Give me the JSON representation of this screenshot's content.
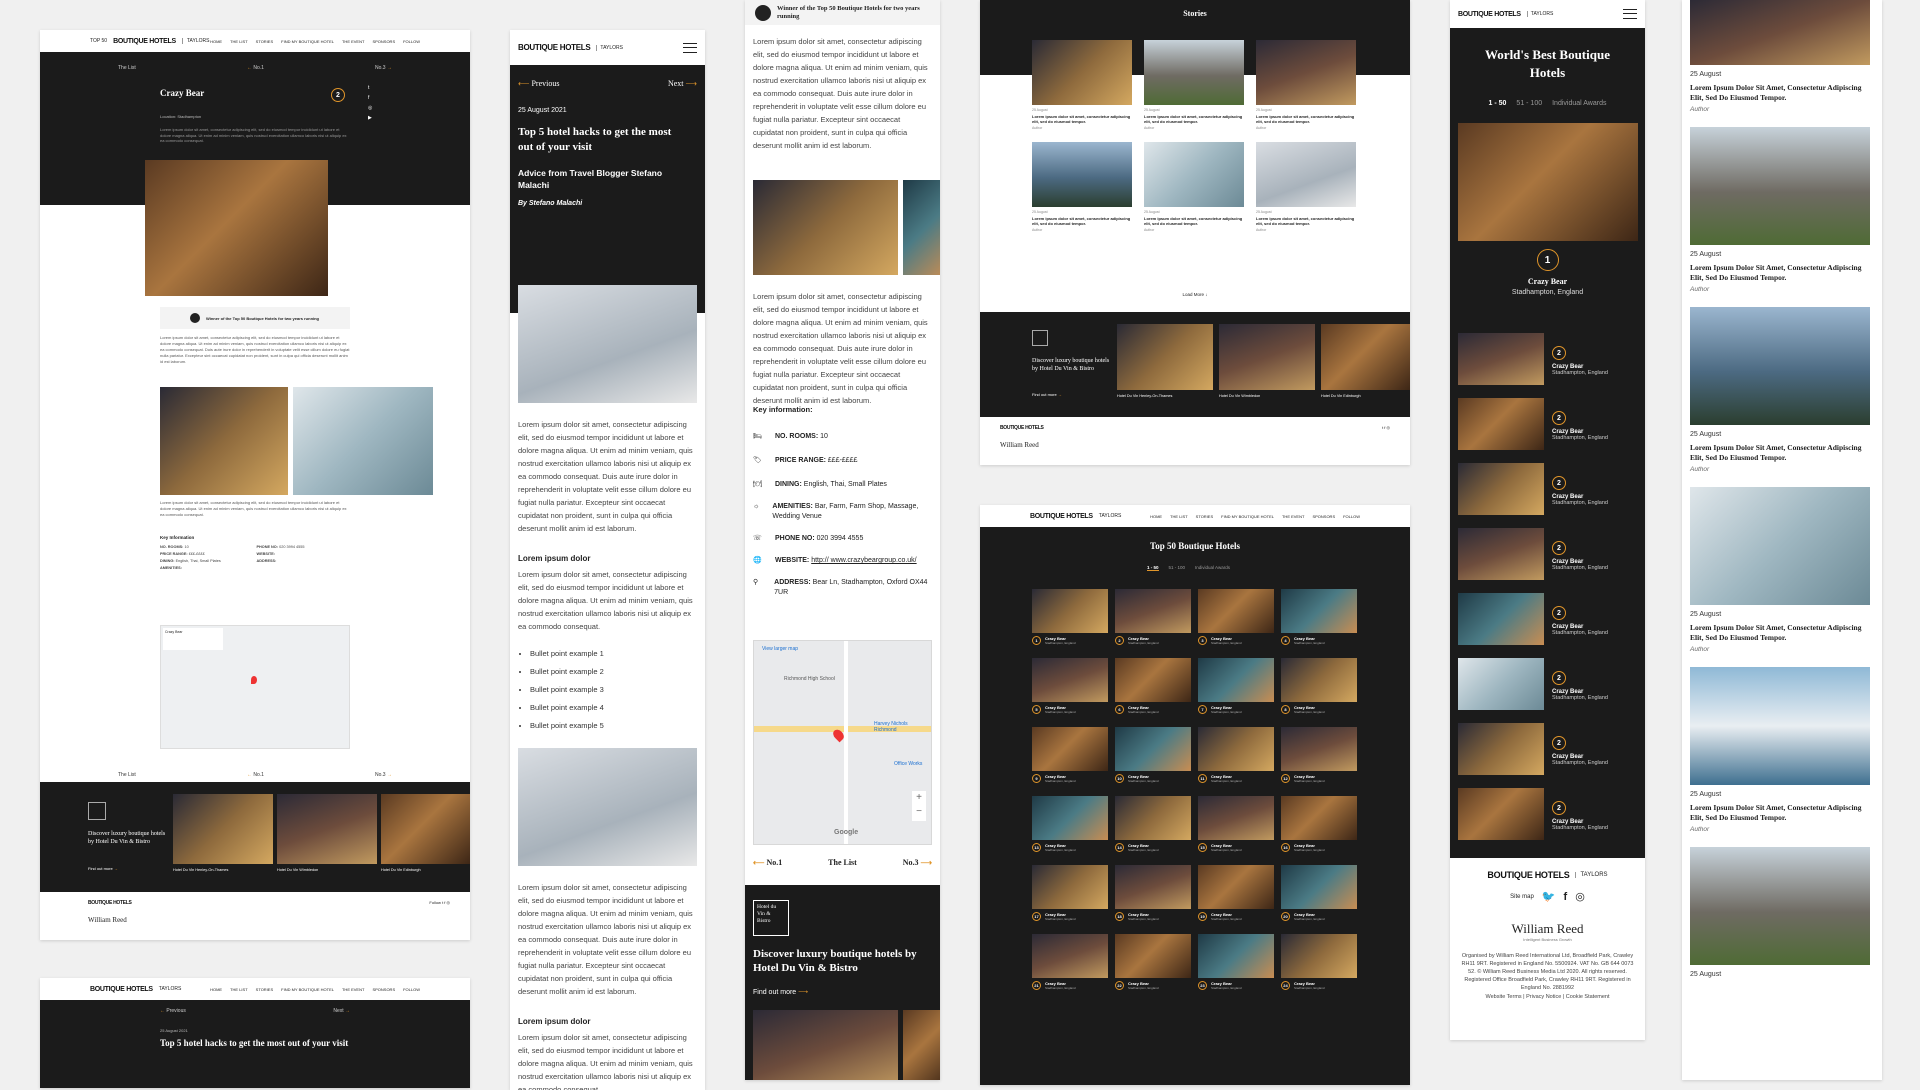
{
  "brand": {
    "name": "BOUTIQUE HOTELS",
    "prefix": "TOP 50",
    "partner": "TAYLORS"
  },
  "nav": [
    "HOME",
    "THE LIST",
    "STORIES",
    "FIND MY BOUTIQUE HOTEL",
    "THE EVENT",
    "SPONSORS",
    "FOLLOW"
  ],
  "colors": {
    "accent": "#e0952a",
    "dark": "#1f1f1f"
  },
  "p1": {
    "crumbs": {
      "list": "The List",
      "prev": "No.1",
      "next": "No.3"
    },
    "title": "Crazy Bear",
    "rank": "2",
    "location": "Location: Stadhampton",
    "winner": "Winner of the Top 50 Boutique Hotels for two years running",
    "key_info": "Key Information",
    "footer": {
      "discover": "Discover luxury boutique hotels by Hotel Du Vin & Bistro",
      "find": "Find out more",
      "hotels": [
        {
          "name": "Hotel Du Vin Henley-On-Thames",
          "loc": "Henley-on-Thames, England"
        },
        {
          "name": "Hotel Du Vin Wimbledon",
          "loc": "London, England"
        },
        {
          "name": "Hotel Du Vin Edinburgh",
          "loc": "Edinburgh, Scotland"
        }
      ],
      "follow": "Follow",
      "publisher": "William Reed"
    }
  },
  "p1b": {
    "prev": "Previous",
    "next": "Next",
    "date": "25 August 2021",
    "title": "Top 5 hotel hacks to get the most out of your visit"
  },
  "p2": {
    "prev": "Previous",
    "next": "Next",
    "date": "25 August 2021",
    "title": "Top 5 hotel hacks to get the most out of your visit",
    "subtitle": "Advice from Travel Blogger Stefano Malachi",
    "byline": "By Stefano Malachi",
    "lorem": "Lorem ipsum dolor sit amet, consectetur adipiscing elit, sed do eiusmod tempor incididunt ut labore et dolore magna aliqua. Ut enim ad minim veniam, quis nostrud exercitation ullamco laboris nisi ut aliquip ex ea commodo consequat. Duis aute irure dolor in reprehenderit in voluptate velit esse cillum dolore eu fugiat nulla pariatur. Excepteur sint occaecat cupidatat non proident, sunt in culpa qui officia deserunt mollit anim id est laborum.",
    "heading": "Lorem ipsum dolor",
    "lorem_short": "Lorem ipsum dolor sit amet, consectetur adipiscing elit, sed do eiusmod tempor incididunt ut labore et dolore magna aliqua. Ut enim ad minim veniam, quis nostrud exercitation ullamco laboris nisi ut aliquip ex ea commodo consequat.",
    "bullets": [
      "Bullet point example 1",
      "Bullet point example 2",
      "Bullet point example 3",
      "Bullet point example 4",
      "Bullet point example 5"
    ]
  },
  "p3": {
    "winner": "Winner of the Top 50 Boutique Hotels for two years running",
    "key_info": "Key information:",
    "info": [
      {
        "label": "NO. ROOMS:",
        "value": "10",
        "icon": "bed-icon"
      },
      {
        "label": "PRICE RANGE:",
        "value": "£££-££££",
        "icon": "price-tag-icon"
      },
      {
        "label": "DINING:",
        "value": "English, Thai, Small Plates",
        "icon": "dining-icon"
      },
      {
        "label": "AMENITIES:",
        "value": "Bar, Farm, Farm Shop, Massage, Wedding Venue",
        "icon": "amenities-icon"
      },
      {
        "label": "PHONE NO:",
        "value": "020 3994 4555",
        "icon": "phone-icon"
      },
      {
        "label": "WEBSITE:",
        "value": "http:// www.crazybeargroup.co.uk/",
        "icon": "globe-icon"
      },
      {
        "label": "ADDRESS:",
        "value": "Bear Ln, Stadhampton, Oxford OX44 7UR",
        "icon": "pin-icon"
      }
    ],
    "map": {
      "label1": "Richmond High School",
      "label2": "Harvey Nichols Richmond",
      "label3": "Office Works",
      "larger": "View larger map",
      "google": "Google"
    },
    "nav": {
      "prev": "No.1",
      "list": "The List",
      "next": "No.3"
    },
    "promo": {
      "logo": "Hotel du Vin & Bistro",
      "title": "Discover luxury boutique hotels by Hotel Du Vin & Bistro",
      "link": "Find out more"
    }
  },
  "p4": {
    "heading": "Stories",
    "story_date": "25 August",
    "story_text": "Lorem ipsum dolor sit amet, consectetur adipiscing elit, sed do eiusmod tempor.",
    "author": "Author",
    "load": "Load More",
    "discover": "Discover luxury boutique hotels by Hotel Du Vin & Bistro",
    "find": "Find out more",
    "hotels": [
      {
        "name": "Hotel Du Vin Henley-On-Thames",
        "loc": "Henley-on-Thames, England"
      },
      {
        "name": "Hotel Du Vin Wimbledon",
        "loc": "London, England"
      },
      {
        "name": "Hotel Du Vin Edinburgh",
        "loc": "Edinburgh, Scotland"
      }
    ],
    "publisher": "William Reed"
  },
  "p5": {
    "heading": "Top 50 Boutique Hotels",
    "tabs": [
      "1 - 50",
      "51 - 100",
      "Individual Awards"
    ],
    "hotel": "Crazy Bear",
    "loc": "Stadhampton, England",
    "ranks": [
      "1",
      "2",
      "3",
      "4",
      "5",
      "6",
      "7",
      "8",
      "9",
      "10",
      "11",
      "12",
      "13",
      "14",
      "15",
      "16",
      "17",
      "18",
      "19",
      "20",
      "21",
      "22",
      "23",
      "24"
    ]
  },
  "p6": {
    "heading": "World's Best Boutique Hotels",
    "tabs": [
      "1 - 50",
      "51 - 100",
      "Individual Awards"
    ],
    "top": {
      "rank": "1",
      "name": "Crazy Bear",
      "loc": "Stadhampton, England"
    },
    "list_rank": "2",
    "list_name": "Crazy Bear",
    "list_loc": "Stadhampton, England",
    "site_map": "Site map",
    "publisher": "William Reed",
    "publisher_sub": "Intelligent Business Growth",
    "legal": "Organised by William Reed International Ltd, Broadfield Park, Crawley RH11 9RT. Registered in England No. 5500924. VAT No. GB 644 0073 52. © William Reed Business Media Ltd 2020. All rights reserved. Registered Office Broadfield Park, Crawley RH11 9RT. Registered in England No. 2881992",
    "links": "Website Terms | Privacy Notice | Cookie Statement"
  },
  "p7": {
    "date": "25 August",
    "title": "Lorem Ipsum Dolor Sit Amet, Consectetur Adipiscing Elit, Sed Do Eiusmod Tempor.",
    "author": "Author"
  }
}
